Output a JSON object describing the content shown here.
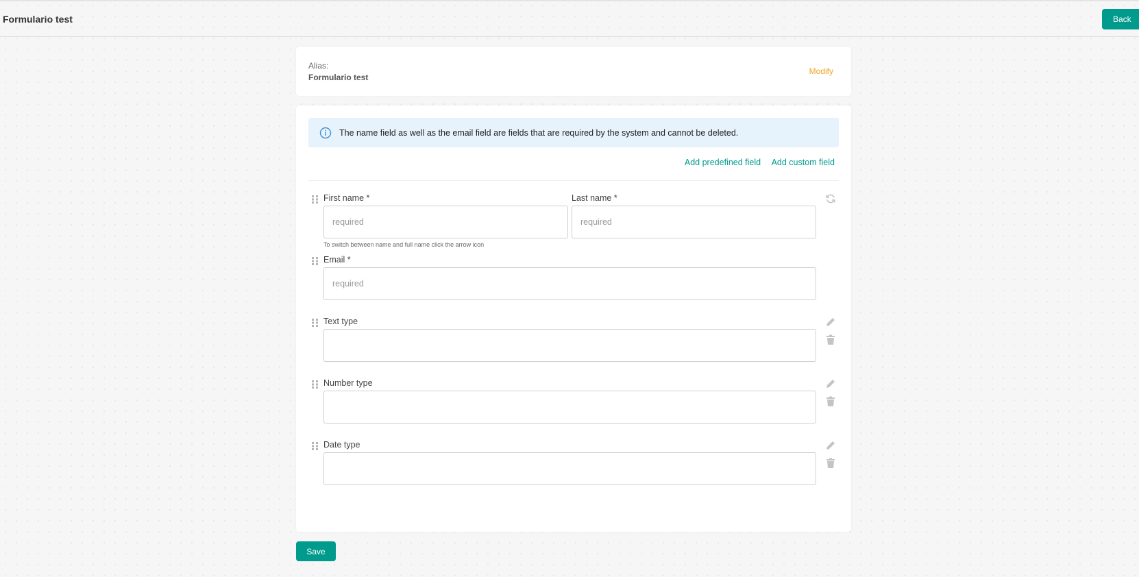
{
  "header": {
    "title": "Formulario test",
    "back_label": "Back"
  },
  "alias": {
    "label": "Alias:",
    "value": "Formulario test",
    "modify_label": "Modify"
  },
  "info": {
    "text": "The name field as well as the email field are fields that are required by the system and cannot be deleted."
  },
  "actions": {
    "add_predefined": "Add predefined field",
    "add_custom": "Add custom field"
  },
  "fields": {
    "first_name": {
      "label": "First name *",
      "placeholder": "required"
    },
    "last_name": {
      "label": "Last name *",
      "placeholder": "required"
    },
    "name_hint": "To switch between name and full name click the arrow icon",
    "email": {
      "label": "Email *",
      "placeholder": "required"
    },
    "text_type": {
      "label": "Text type"
    },
    "number_type": {
      "label": "Number type"
    },
    "date_type": {
      "label": "Date type"
    }
  },
  "footer": {
    "save_label": "Save"
  },
  "colors": {
    "accent": "#009b8c",
    "modify": "#f0a020",
    "info_bg": "#e7f3fc",
    "info_icon": "#3d8fd6"
  },
  "icons": [
    "drag-handle-icon",
    "info-icon",
    "refresh-icon",
    "pencil-icon",
    "trash-icon"
  ]
}
